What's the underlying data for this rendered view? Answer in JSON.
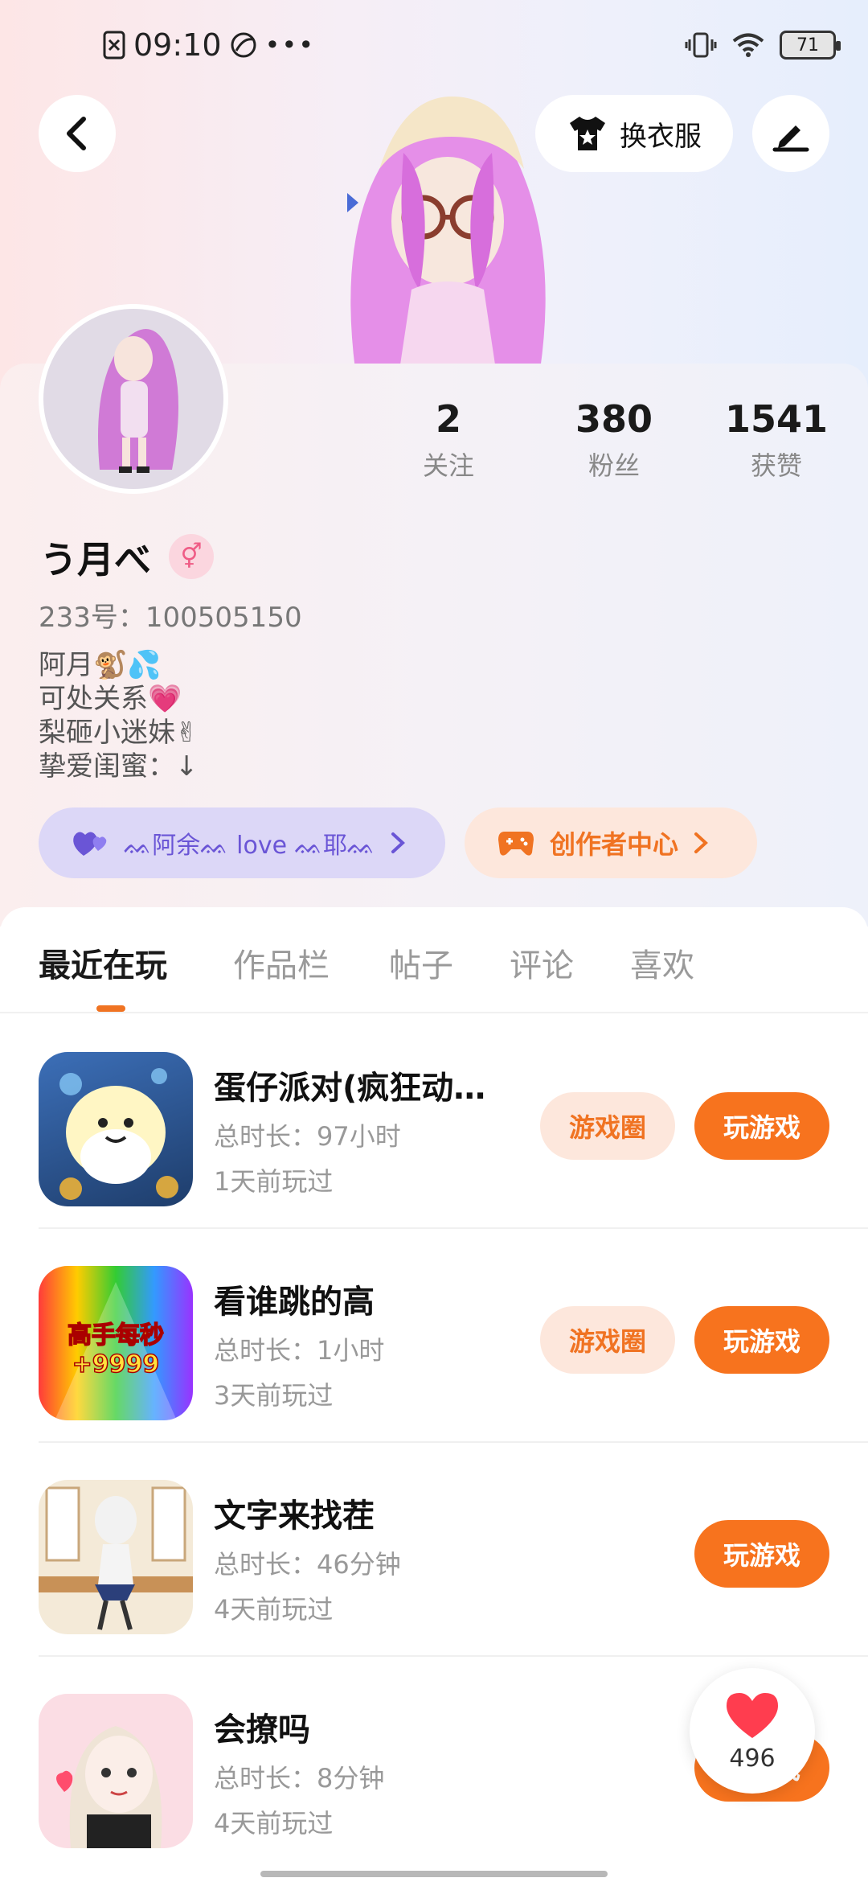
{
  "status_bar": {
    "time": "09:10",
    "battery": "71"
  },
  "header": {
    "dress_up_label": "换衣服"
  },
  "profile": {
    "nickname": "う月べ",
    "gender_symbol": "⚥",
    "uid": "233号：100505150",
    "bio": [
      "阿月🐒💦",
      "可处关系💗",
      "梨砸小迷妹✌",
      "挚爱闺蜜：↓"
    ],
    "stats": [
      {
        "num": "2",
        "label": "关注"
      },
      {
        "num": "380",
        "label": "粉丝"
      },
      {
        "num": "1541",
        "label": "获赞"
      }
    ],
    "relation_chip": "ᨐ阿余ᨐ love ᨐ耶ᨐ",
    "creator_chip": "创作者中心"
  },
  "tabs": [
    "最近在玩",
    "作品栏",
    "帖子",
    "评论",
    "喜欢"
  ],
  "games": [
    {
      "title": "蛋仔派对(疯狂动…",
      "duration": "总时长：97小时",
      "last_played": "1天前玩过",
      "circle_label": "游戏圈",
      "play_label": "玩游戏",
      "icon_text": ""
    },
    {
      "title": "看谁跳的高",
      "duration": "总时长：1小时",
      "last_played": "3天前玩过",
      "circle_label": "游戏圈",
      "play_label": "玩游戏",
      "icon_text": "高手每秒+9999"
    },
    {
      "title": "文字来找茬",
      "duration": "总时长：46分钟",
      "last_played": "4天前玩过",
      "circle_label": "",
      "play_label": "玩游戏",
      "icon_text": ""
    },
    {
      "title": "会撩吗",
      "duration": "总时长：8分钟",
      "last_played": "4天前玩过",
      "circle_label": "",
      "play_label": "玩游戏",
      "icon_text": ""
    }
  ],
  "like_float": {
    "count": "496"
  },
  "colors": {
    "accent": "#f7731e",
    "accent_soft": "#fde7dc",
    "purple": "#6a55d6"
  }
}
